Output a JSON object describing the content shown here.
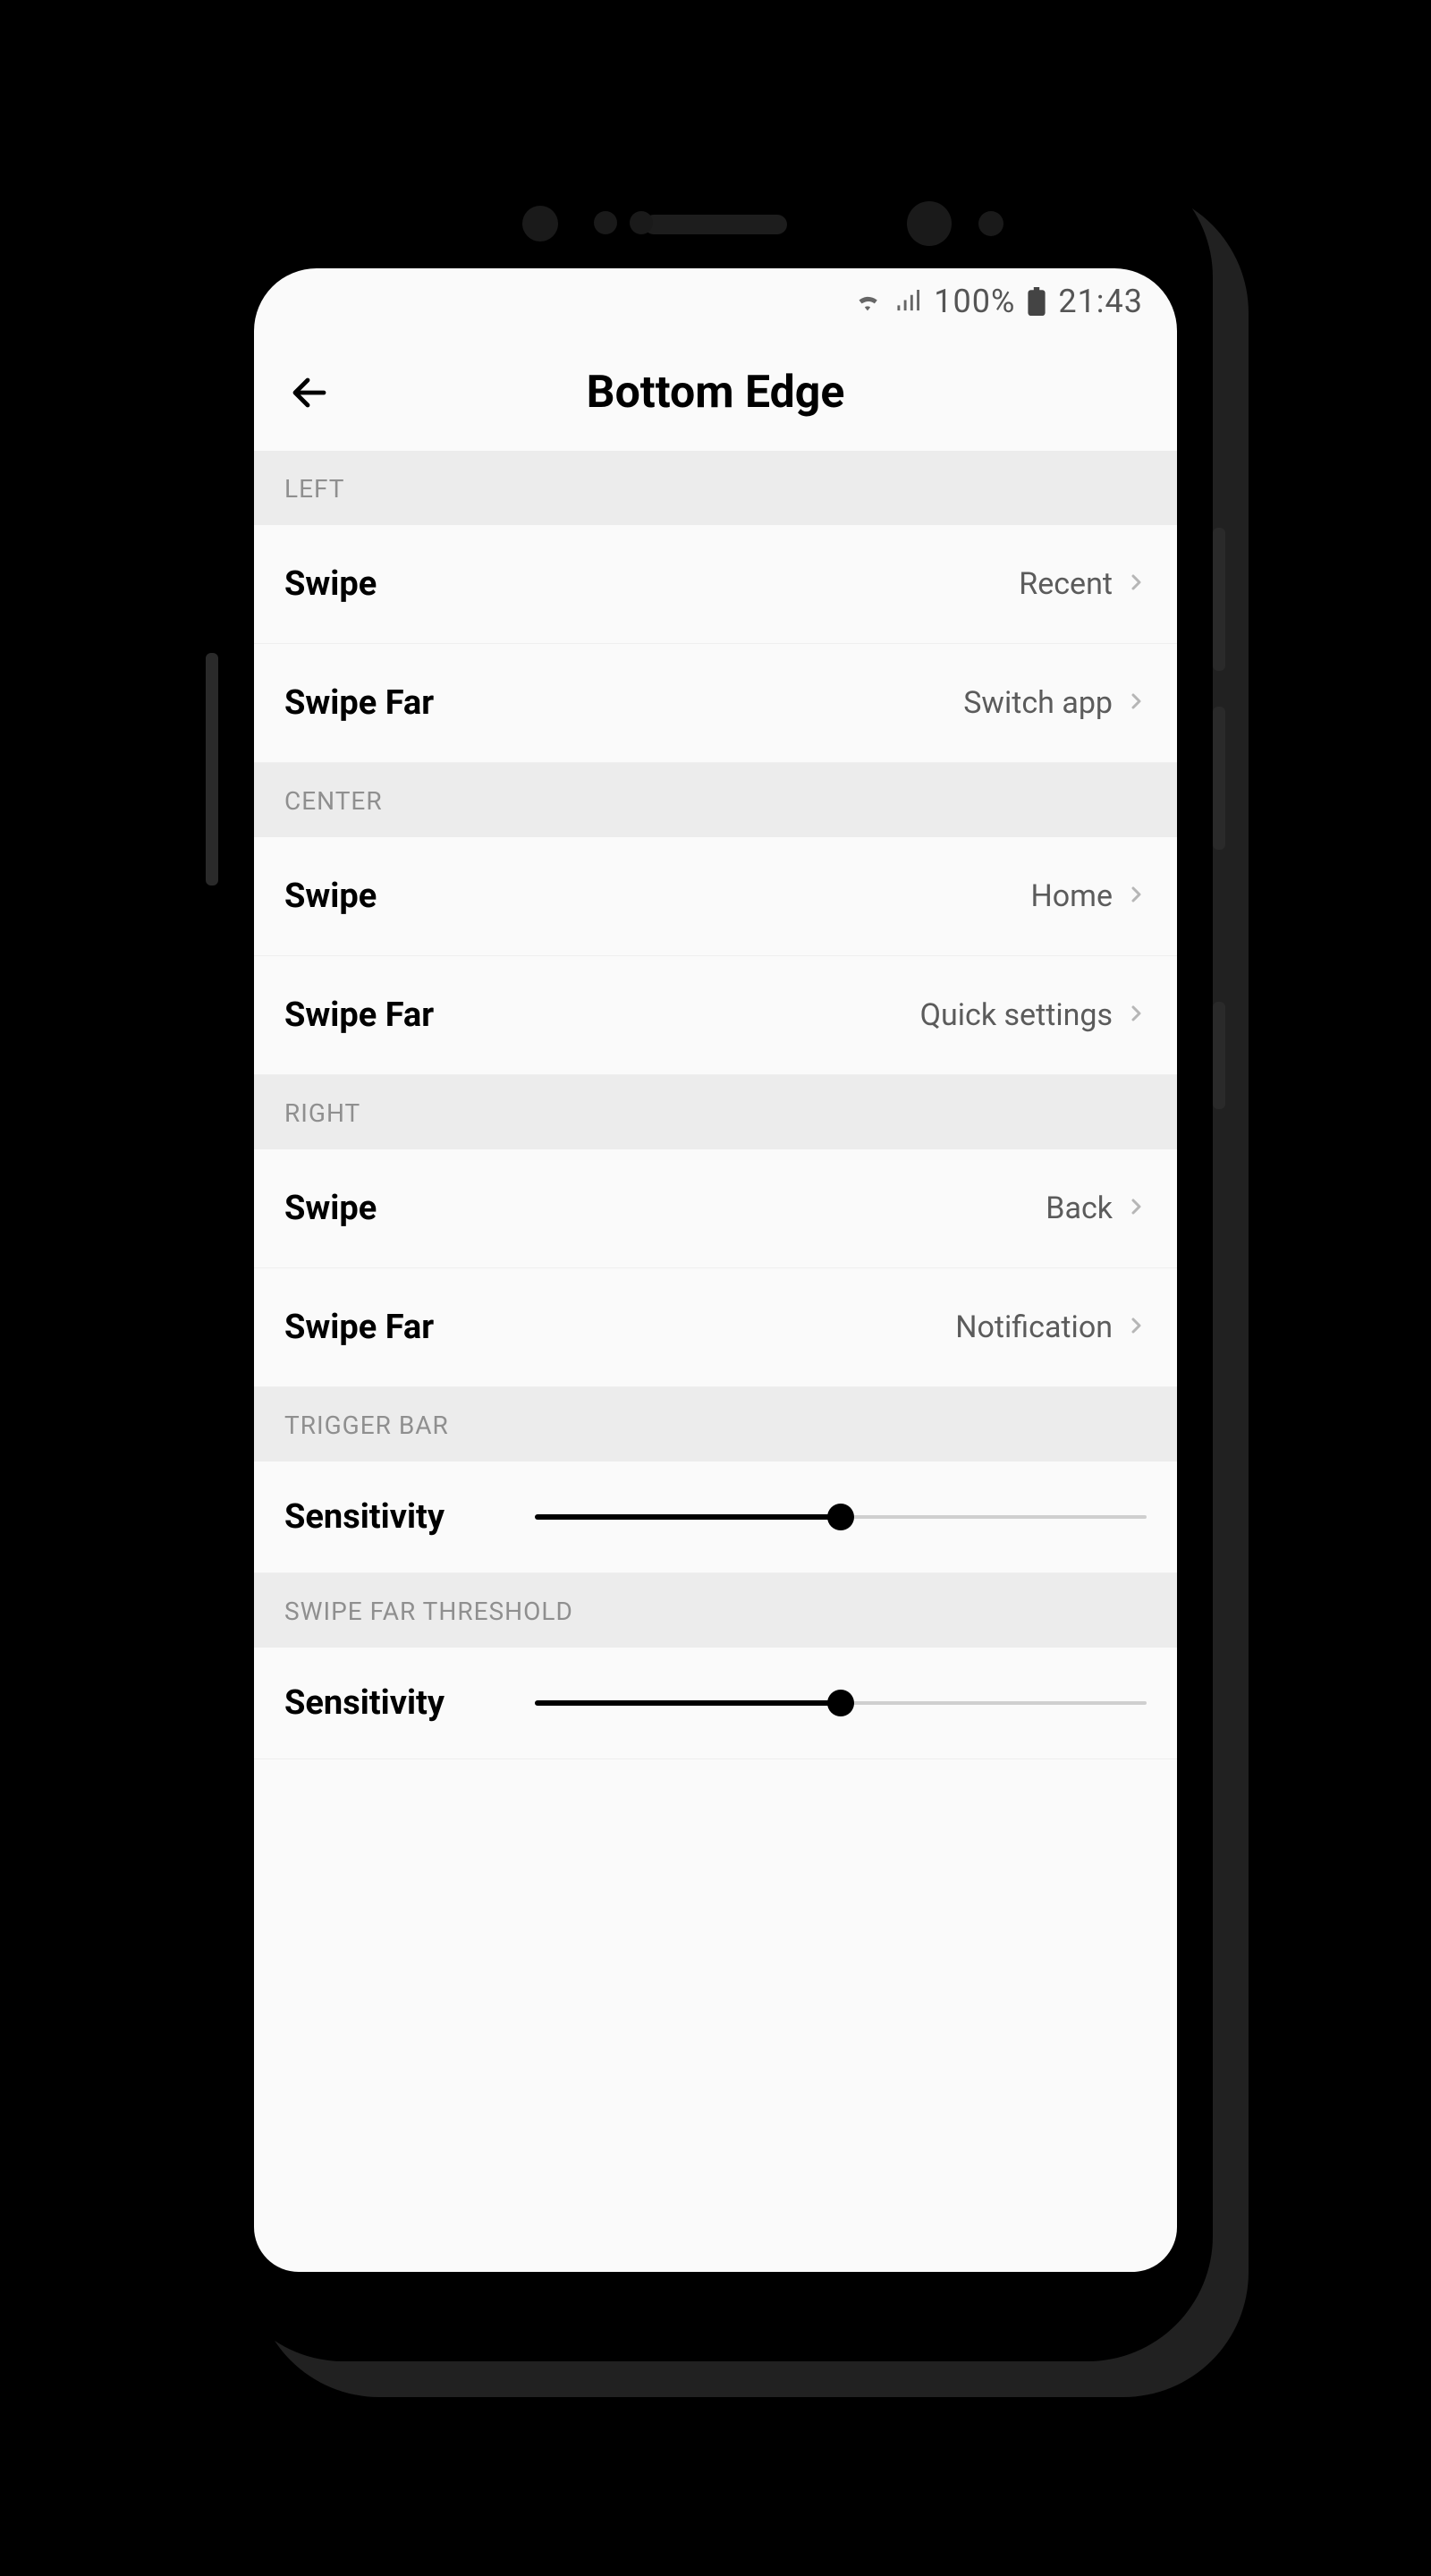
{
  "status": {
    "battery": "100%",
    "time": "21:43"
  },
  "appbar": {
    "title": "Bottom Edge"
  },
  "sections": {
    "left": {
      "header": "LEFT",
      "swipe_label": "Swipe",
      "swipe_value": "Recent",
      "swipefar_label": "Swipe Far",
      "swipefar_value": "Switch app"
    },
    "center": {
      "header": "CENTER",
      "swipe_label": "Swipe",
      "swipe_value": "Home",
      "swipefar_label": "Swipe Far",
      "swipefar_value": "Quick settings"
    },
    "right": {
      "header": "RIGHT",
      "swipe_label": "Swipe",
      "swipe_value": "Back",
      "swipefar_label": "Swipe Far",
      "swipefar_value": "Notification"
    }
  },
  "trigger": {
    "header": "TRIGGER BAR",
    "label": "Sensitivity",
    "value_pct": 50
  },
  "threshold": {
    "header": "SWIPE FAR THRESHOLD",
    "label": "Sensitivity",
    "value_pct": 50
  }
}
